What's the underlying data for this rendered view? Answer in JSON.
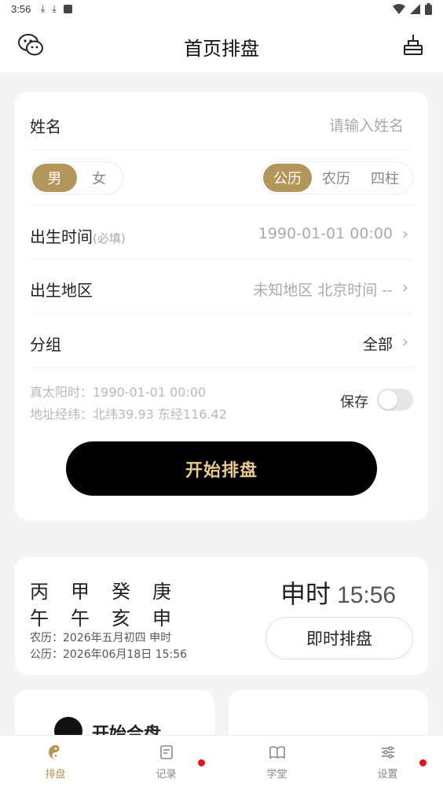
{
  "status_bar": {
    "time": "3:56",
    "icons": [
      "download-icon",
      "download-icon",
      "a-box-icon"
    ]
  },
  "header": {
    "title": "首页排盘"
  },
  "form": {
    "name_label": "姓名",
    "name_placeholder": "请输入姓名",
    "gender": {
      "options": [
        "男",
        "女"
      ],
      "selected": "男"
    },
    "calendar": {
      "options": [
        "公历",
        "农历",
        "四柱"
      ],
      "selected": "公历"
    },
    "birth_time": {
      "label": "出生时间",
      "hint": "(必填)",
      "value": "1990-01-01 00:00"
    },
    "birth_region": {
      "label": "出生地区",
      "value": "未知地区 北京时间 --"
    },
    "group": {
      "label": "分组",
      "value": "全部"
    },
    "solar_time": "真太阳时：1990-01-01 00:00",
    "coordinates": "地址经纬：北纬39.93 东经116.42",
    "save_label": "保存",
    "save_enabled": false,
    "start_button": "开始排盘"
  },
  "now_card": {
    "stems": [
      "丙",
      "甲",
      "癸",
      "庚"
    ],
    "branches": [
      "午",
      "午",
      "亥",
      "申"
    ],
    "lunar": "农历：2026年五月初四 申时",
    "solar": "公历：2026年06月18日 15:56",
    "shichen": "申时",
    "clock": "15:56",
    "button": "即时排盘"
  },
  "promo": {
    "left_text": "开始合盘"
  },
  "tabs": [
    {
      "label": "排盘",
      "icon": "yin-yang-icon",
      "active": true,
      "badge": false
    },
    {
      "label": "记录",
      "icon": "notes-icon",
      "active": false,
      "badge": true
    },
    {
      "label": "学堂",
      "icon": "book-icon",
      "active": false,
      "badge": false
    },
    {
      "label": "设置",
      "icon": "sliders-icon",
      "active": false,
      "badge": true
    }
  ],
  "colors": {
    "accent": "#b39659",
    "start_text": "#e9c98b",
    "badge": "#e0161e"
  }
}
